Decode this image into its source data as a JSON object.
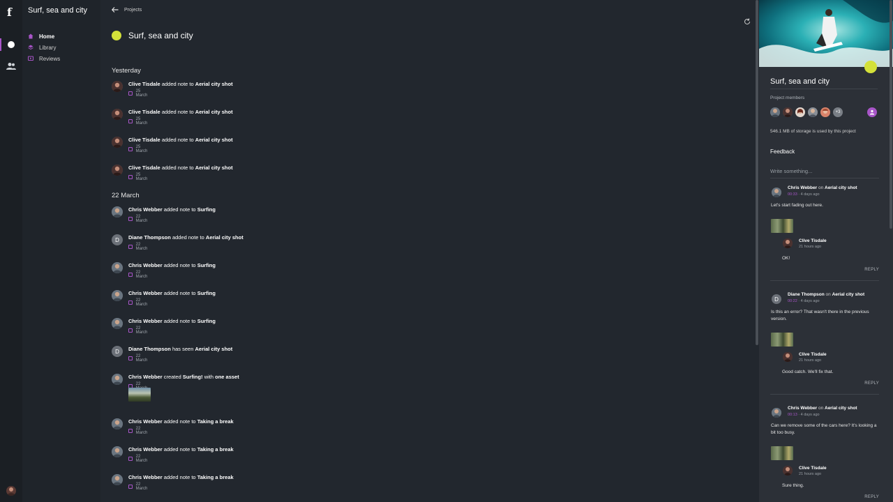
{
  "app": {
    "logo": "f",
    "project_title": "Surf, sea and city"
  },
  "nav": {
    "items": [
      {
        "label": "Home",
        "icon": "home-icon",
        "active": true
      },
      {
        "label": "Library",
        "icon": "library-icon",
        "active": false
      },
      {
        "label": "Reviews",
        "icon": "reviews-icon",
        "active": false
      }
    ]
  },
  "main": {
    "back_label": "Projects",
    "title": "Surf, sea and city",
    "sections": [
      {
        "title": "Yesterday",
        "activities": [
          {
            "user": "Clive Tisdale",
            "action": "added note to",
            "target": "Aerial city shot",
            "date": "25 March"
          },
          {
            "user": "Clive Tisdale",
            "action": "added note to",
            "target": "Aerial city shot",
            "date": "25 March"
          },
          {
            "user": "Clive Tisdale",
            "action": "added note to",
            "target": "Aerial city shot",
            "date": "25 March"
          },
          {
            "user": "Clive Tisdale",
            "action": "added note to",
            "target": "Aerial city shot",
            "date": "25 March"
          }
        ]
      },
      {
        "title": "22 March",
        "activities": [
          {
            "user": "Chris Webber",
            "action": "added note to",
            "target": "Surfing",
            "date": "22 March"
          },
          {
            "user": "Diane Thompson",
            "action": "added note to",
            "target": "Aerial city shot",
            "date": "22 March",
            "initial": "D"
          },
          {
            "user": "Chris Webber",
            "action": "added note to",
            "target": "Surfing",
            "date": "22 March"
          },
          {
            "user": "Chris Webber",
            "action": "added note to",
            "target": "Surfing",
            "date": "22 March"
          },
          {
            "user": "Chris Webber",
            "action": "added note to",
            "target": "Surfing",
            "date": "22 March"
          },
          {
            "user": "Diane Thompson",
            "action": "has seen",
            "target": "Aerial city shot",
            "date": "22 March",
            "initial": "D"
          },
          {
            "user": "Chris Webber",
            "action": "created",
            "target": "Surfing!",
            "suffix_pre": "with",
            "suffix": "one asset",
            "date": "22 March"
          },
          {
            "user": "Chris Webber",
            "action": "added note to",
            "target": "Taking a break",
            "date": "22 March"
          },
          {
            "user": "Chris Webber",
            "action": "added note to",
            "target": "Taking a break",
            "date": "22 March"
          },
          {
            "user": "Chris Webber",
            "action": "added note to",
            "target": "Taking a break",
            "date": "22 March"
          }
        ]
      }
    ]
  },
  "panel": {
    "title": "Surf, sea and city",
    "members_label": "Project members",
    "members_more": "+3",
    "storage": "546.1 MB of storage is used by this project",
    "feedback_label": "Feedback",
    "write_placeholder": "Write something...",
    "comments": [
      {
        "author": "Chris Webber",
        "on": "on",
        "target": "Aerial city shot",
        "timecode": "00:33",
        "ago": " · 4 days ago",
        "body": "Let's start fading out here.",
        "reply": {
          "name": "Clive Tisdale",
          "time": "21 hours ago",
          "body": "OK!"
        },
        "reply_label": "REPLY"
      },
      {
        "author": "Diane Thompson",
        "on": "on",
        "target": "Aerial city shot",
        "initial": "D",
        "timecode": "00:22",
        "ago": " · 4 days ago",
        "body": "Is this an error? That wasn't there in the previous version.",
        "reply": {
          "name": "Clive Tisdale",
          "time": "21 hours ago",
          "body": "Good catch. We'll fix that."
        },
        "reply_label": "REPLY"
      },
      {
        "author": "Chris Webber",
        "on": "on",
        "target": "Aerial city shot",
        "timecode": "00:13",
        "ago": " · 4 days ago",
        "body": "Can we remove some of the cars here? It's looking a bit too busy.",
        "reply": {
          "name": "Clive Tisdale",
          "time": "21 hours ago",
          "body": "Sure thing."
        },
        "reply_label": "REPLY"
      }
    ]
  },
  "colors": {
    "accent": "#a855c8",
    "project_dot": "#d4e13a",
    "background": "#22272e"
  }
}
